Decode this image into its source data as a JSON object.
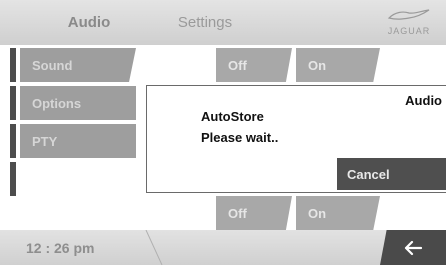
{
  "header": {
    "tab_audio": "Audio",
    "tab_settings": "Settings",
    "brand": "JAGUAR"
  },
  "menu": {
    "items": [
      {
        "label": "Sound"
      },
      {
        "label": "Options"
      },
      {
        "label": "PTY"
      }
    ]
  },
  "toggles": {
    "row_top": {
      "off_label": "Off",
      "on_label": "On"
    },
    "row_bottom": {
      "off_label": "Off",
      "on_label": "On"
    }
  },
  "popup": {
    "title": "Audio",
    "line1": "AutoStore",
    "line2": "Please wait..",
    "cancel_label": "Cancel"
  },
  "footer": {
    "time": "12 : 26 pm",
    "back_icon": "arrow-left-icon"
  },
  "colors": {
    "header_bg": "#d8d8d8",
    "menu_tile": "#9e9e9e",
    "toggle_tile": "#a8a8a8",
    "cancel_bg": "#4f4f4f",
    "back_bg": "#4a4a4a"
  }
}
